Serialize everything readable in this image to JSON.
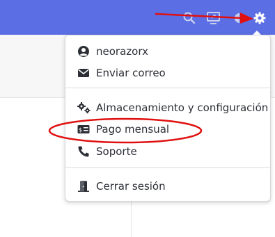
{
  "header": {
    "icons": [
      "search-icon",
      "screen-share-icon",
      "theme-icon",
      "gear-icon"
    ],
    "accent": "#5b6ee3"
  },
  "menu": {
    "items": [
      {
        "label": "neorazorx",
        "icon": "user-circle-icon"
      },
      {
        "label": "Enviar correo",
        "icon": "envelope-icon"
      },
      {
        "label": "Almacenamiento y configuración",
        "icon": "gears-icon"
      },
      {
        "label": "Pago mensual",
        "icon": "billing-icon"
      },
      {
        "label": "Soporte",
        "icon": "phone-icon"
      },
      {
        "label": "Cerrar sesión",
        "icon": "exit-door-icon"
      }
    ]
  },
  "annotations": {
    "arrow_color": "#e01010",
    "highlight_color": "#e01010"
  }
}
